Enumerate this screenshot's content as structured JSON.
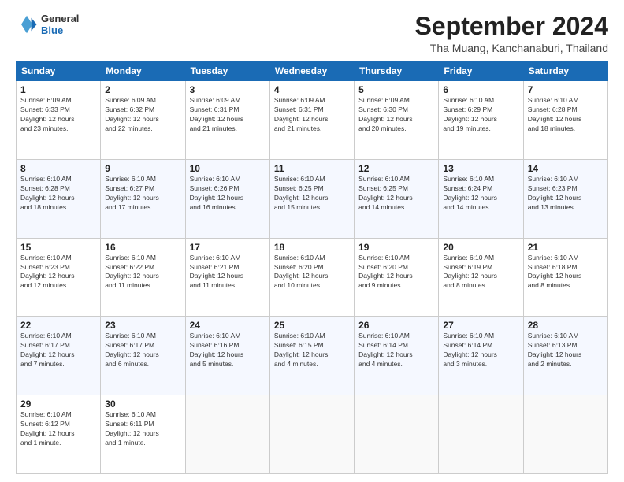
{
  "logo": {
    "line1": "General",
    "line2": "Blue"
  },
  "title": "September 2024",
  "location": "Tha Muang, Kanchanaburi, Thailand",
  "headers": [
    "Sunday",
    "Monday",
    "Tuesday",
    "Wednesday",
    "Thursday",
    "Friday",
    "Saturday"
  ],
  "weeks": [
    [
      {
        "day": "1",
        "info": "Sunrise: 6:09 AM\nSunset: 6:33 PM\nDaylight: 12 hours\nand 23 minutes."
      },
      {
        "day": "2",
        "info": "Sunrise: 6:09 AM\nSunset: 6:32 PM\nDaylight: 12 hours\nand 22 minutes."
      },
      {
        "day": "3",
        "info": "Sunrise: 6:09 AM\nSunset: 6:31 PM\nDaylight: 12 hours\nand 21 minutes."
      },
      {
        "day": "4",
        "info": "Sunrise: 6:09 AM\nSunset: 6:31 PM\nDaylight: 12 hours\nand 21 minutes."
      },
      {
        "day": "5",
        "info": "Sunrise: 6:09 AM\nSunset: 6:30 PM\nDaylight: 12 hours\nand 20 minutes."
      },
      {
        "day": "6",
        "info": "Sunrise: 6:10 AM\nSunset: 6:29 PM\nDaylight: 12 hours\nand 19 minutes."
      },
      {
        "day": "7",
        "info": "Sunrise: 6:10 AM\nSunset: 6:28 PM\nDaylight: 12 hours\nand 18 minutes."
      }
    ],
    [
      {
        "day": "8",
        "info": "Sunrise: 6:10 AM\nSunset: 6:28 PM\nDaylight: 12 hours\nand 18 minutes."
      },
      {
        "day": "9",
        "info": "Sunrise: 6:10 AM\nSunset: 6:27 PM\nDaylight: 12 hours\nand 17 minutes."
      },
      {
        "day": "10",
        "info": "Sunrise: 6:10 AM\nSunset: 6:26 PM\nDaylight: 12 hours\nand 16 minutes."
      },
      {
        "day": "11",
        "info": "Sunrise: 6:10 AM\nSunset: 6:25 PM\nDaylight: 12 hours\nand 15 minutes."
      },
      {
        "day": "12",
        "info": "Sunrise: 6:10 AM\nSunset: 6:25 PM\nDaylight: 12 hours\nand 14 minutes."
      },
      {
        "day": "13",
        "info": "Sunrise: 6:10 AM\nSunset: 6:24 PM\nDaylight: 12 hours\nand 14 minutes."
      },
      {
        "day": "14",
        "info": "Sunrise: 6:10 AM\nSunset: 6:23 PM\nDaylight: 12 hours\nand 13 minutes."
      }
    ],
    [
      {
        "day": "15",
        "info": "Sunrise: 6:10 AM\nSunset: 6:23 PM\nDaylight: 12 hours\nand 12 minutes."
      },
      {
        "day": "16",
        "info": "Sunrise: 6:10 AM\nSunset: 6:22 PM\nDaylight: 12 hours\nand 11 minutes."
      },
      {
        "day": "17",
        "info": "Sunrise: 6:10 AM\nSunset: 6:21 PM\nDaylight: 12 hours\nand 11 minutes."
      },
      {
        "day": "18",
        "info": "Sunrise: 6:10 AM\nSunset: 6:20 PM\nDaylight: 12 hours\nand 10 minutes."
      },
      {
        "day": "19",
        "info": "Sunrise: 6:10 AM\nSunset: 6:20 PM\nDaylight: 12 hours\nand 9 minutes."
      },
      {
        "day": "20",
        "info": "Sunrise: 6:10 AM\nSunset: 6:19 PM\nDaylight: 12 hours\nand 8 minutes."
      },
      {
        "day": "21",
        "info": "Sunrise: 6:10 AM\nSunset: 6:18 PM\nDaylight: 12 hours\nand 8 minutes."
      }
    ],
    [
      {
        "day": "22",
        "info": "Sunrise: 6:10 AM\nSunset: 6:17 PM\nDaylight: 12 hours\nand 7 minutes."
      },
      {
        "day": "23",
        "info": "Sunrise: 6:10 AM\nSunset: 6:17 PM\nDaylight: 12 hours\nand 6 minutes."
      },
      {
        "day": "24",
        "info": "Sunrise: 6:10 AM\nSunset: 6:16 PM\nDaylight: 12 hours\nand 5 minutes."
      },
      {
        "day": "25",
        "info": "Sunrise: 6:10 AM\nSunset: 6:15 PM\nDaylight: 12 hours\nand 4 minutes."
      },
      {
        "day": "26",
        "info": "Sunrise: 6:10 AM\nSunset: 6:14 PM\nDaylight: 12 hours\nand 4 minutes."
      },
      {
        "day": "27",
        "info": "Sunrise: 6:10 AM\nSunset: 6:14 PM\nDaylight: 12 hours\nand 3 minutes."
      },
      {
        "day": "28",
        "info": "Sunrise: 6:10 AM\nSunset: 6:13 PM\nDaylight: 12 hours\nand 2 minutes."
      }
    ],
    [
      {
        "day": "29",
        "info": "Sunrise: 6:10 AM\nSunset: 6:12 PM\nDaylight: 12 hours\nand 1 minute."
      },
      {
        "day": "30",
        "info": "Sunrise: 6:10 AM\nSunset: 6:11 PM\nDaylight: 12 hours\nand 1 minute."
      },
      {
        "day": "",
        "info": ""
      },
      {
        "day": "",
        "info": ""
      },
      {
        "day": "",
        "info": ""
      },
      {
        "day": "",
        "info": ""
      },
      {
        "day": "",
        "info": ""
      }
    ]
  ]
}
